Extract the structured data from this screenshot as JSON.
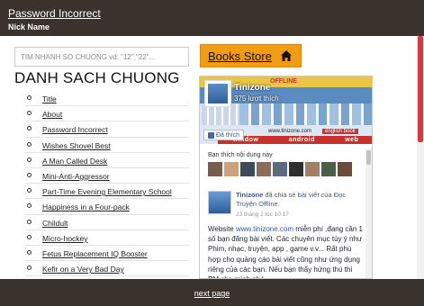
{
  "header": {
    "title": "Password Incorrect",
    "subtitle": "Nick Name"
  },
  "search": {
    "placeholder": "TIM NHANH SO CHUONG vd: \"12\",\"22\"..."
  },
  "chapter_list": {
    "heading": "DANH SACH CHUONG",
    "items": [
      "Title",
      "About",
      "Password Incorrect",
      "Wishes Shovel Best",
      "A Man Called Desk",
      "Mini-Anti-Aggressor",
      "Part-Time Evening Elementary School",
      "Happiness in a Four-pack",
      "Childult",
      "Micro-hockey",
      "Fetus Replacement IQ Booster",
      "Kefir on a Very Bad Day"
    ]
  },
  "store": {
    "label": "Books Store",
    "icon": "home-icon"
  },
  "facebook_widget": {
    "page_name": "Tinizone",
    "likes": "375 lượt thích",
    "like_button": "Đã thích",
    "cover_text": {
      "offline": "OFFLINE",
      "site": "www.tinizone.com",
      "english": "english book",
      "band": [
        "window",
        "android",
        "web"
      ]
    },
    "friends_text": "Bạn thích nội dung này",
    "post": {
      "author": "Tinizone",
      "action": "đã chia sẻ",
      "link1": "bài viết",
      "of": "của",
      "link2": "Đọc Truyện Offline.",
      "time": "23 tháng 2 lúc 10:17",
      "body_prefix": "Website",
      "body_link": "www.tinizone.com",
      "body_rest": "miễn phí ,đang cần 1 số bạn đăng bài viết. Các chuyên mục tùy ý như Phim, nhạc, truyện, app , game v.v... Rất phù hợp cho quảng cáo bài viết cũng như ứng dụng riêng của các bạn. Nếu bạn thấy hứng thú thì PM cho mình nhé."
    }
  },
  "footer": {
    "next_label": "next page"
  },
  "colors": {
    "bar": "#3a322d",
    "store_button": "#f39c12",
    "scroll_thumb": "#d9363e",
    "fb_link": "#365899"
  }
}
